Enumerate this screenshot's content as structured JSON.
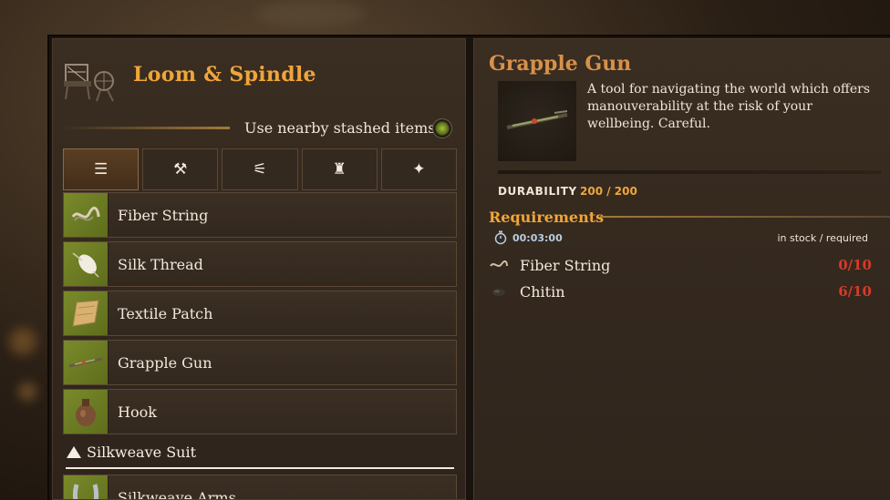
{
  "colors": {
    "accent": "#f0a53a",
    "title_item": "#d7914a",
    "missing": "#d63a2a",
    "thumb_bg": "#7a8a2a"
  },
  "station": {
    "title": "Loom & Spindle",
    "icon": "loom-spinning-wheel-icon"
  },
  "stash": {
    "label": "Use nearby stashed items",
    "enabled": true
  },
  "tabs": [
    {
      "icon": "list-icon",
      "glyph": "☰",
      "active": true
    },
    {
      "icon": "hammer-icon",
      "glyph": "⚒",
      "active": false
    },
    {
      "icon": "tool-icon",
      "glyph": "⚟",
      "active": false
    },
    {
      "icon": "armor-icon",
      "glyph": "♜",
      "active": false
    },
    {
      "icon": "sparkle-icon",
      "glyph": "✦",
      "active": false
    }
  ],
  "recipes": [
    {
      "name": "Fiber String",
      "icon": "fiber-string-icon"
    },
    {
      "name": "Silk Thread",
      "icon": "silk-thread-icon"
    },
    {
      "name": "Textile Patch",
      "icon": "textile-patch-icon"
    },
    {
      "name": "Grapple Gun",
      "icon": "grapple-gun-icon"
    },
    {
      "name": "Hook",
      "icon": "hook-icon"
    }
  ],
  "section": {
    "label": "Silkweave Suit"
  },
  "section_items": [
    {
      "name": "Silkweave Arms",
      "icon": "silkweave-arms-icon"
    }
  ],
  "detail": {
    "title": "Grapple Gun",
    "description": "A tool for navigating the world which offers manouverability at the risk of your wellbeing. Careful.",
    "durability_label": "DURABILITY",
    "durability_current": 200,
    "durability_max": 200,
    "durability_text": "200 / 200",
    "requirements_label": "Requirements",
    "craft_time": "00:03:00",
    "stock_label": "in stock / required",
    "requirements": [
      {
        "name": "Fiber String",
        "icon": "fiber-string-icon",
        "qty": "0/10"
      },
      {
        "name": "Chitin",
        "icon": "chitin-icon",
        "qty": "6/10"
      }
    ]
  }
}
